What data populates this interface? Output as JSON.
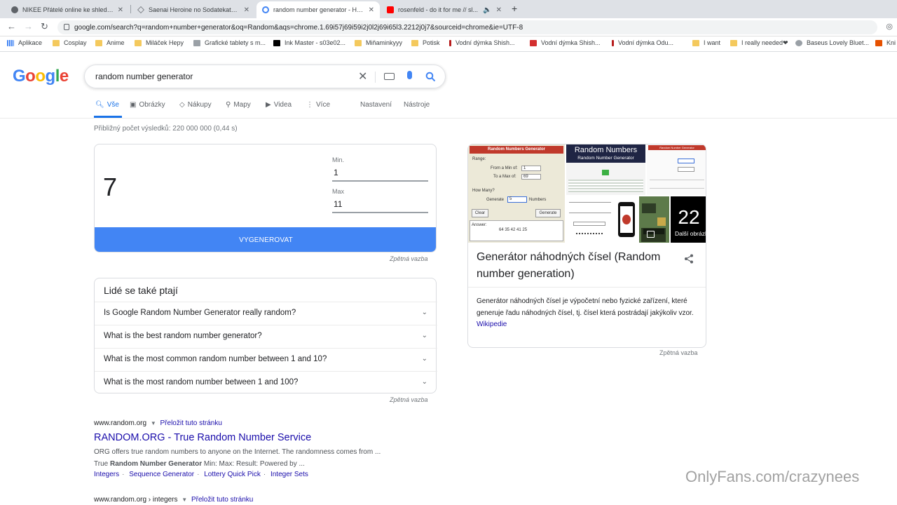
{
  "browser": {
    "tabs": [
      {
        "title": "NIKEE Přátelé online ke shlednutí",
        "active": false,
        "favicon_color": "#5f6368"
      },
      {
        "title": "Saenai Heroine no Sodatekata (C...",
        "active": false,
        "favicon_color": "#5f6368"
      },
      {
        "title": "random number generator - Hle...",
        "active": true,
        "favicon_color": "#4285f4"
      },
      {
        "title": "rosenfeld - do it for me // sl...",
        "active": false,
        "favicon_color": "#ff0000"
      }
    ],
    "address": "google.com/search?q=random+number+generator&oq=Random&aqs=chrome.1.69i57j69i59i2j0l2j69i65l3.2212j0j7&sourceid=chrome&ie=UTF-8",
    "bookmarks": [
      {
        "label": "Aplikace",
        "icon": "apps-grid-icon"
      },
      {
        "label": "Cosplay",
        "icon": "folder-icon"
      },
      {
        "label": "Anime",
        "icon": "folder-icon"
      },
      {
        "label": "Miláček Hepy",
        "icon": "folder-icon"
      },
      {
        "label": "Grafické tablety s m...",
        "icon": "page-icon"
      },
      {
        "label": "Ink Master - s03e02...",
        "icon": "video-icon"
      },
      {
        "label": "Miňaminkyyy",
        "icon": "folder-icon"
      },
      {
        "label": "Potisk",
        "icon": "folder-icon"
      },
      {
        "label": "Vodní dýmka Shish...",
        "icon": "hookah-icon"
      },
      {
        "label": "Vodní dýmka Shish...",
        "icon": "store-icon"
      },
      {
        "label": "Vodní dýmka Odu...",
        "icon": "hookah-icon"
      },
      {
        "label": "I want",
        "icon": "folder-icon"
      },
      {
        "label": "I really needed❤",
        "icon": "folder-icon"
      },
      {
        "label": "Baseus Lovely Bluet...",
        "icon": "page-icon"
      },
      {
        "label": "Kni",
        "icon": "page-icon"
      }
    ]
  },
  "google": {
    "logo": "Google",
    "query": "random number generator",
    "tabs": [
      {
        "label": "Vše",
        "icon": "search-icon",
        "active": true
      },
      {
        "label": "Obrázky",
        "icon": "image-icon",
        "active": false
      },
      {
        "label": "Nákupy",
        "icon": "tag-icon",
        "active": false
      },
      {
        "label": "Mapy",
        "icon": "map-pin-icon",
        "active": false
      },
      {
        "label": "Videa",
        "icon": "video-icon",
        "active": false
      },
      {
        "label": "Více",
        "icon": "more-vert-icon",
        "active": false
      }
    ],
    "settings_label": "Nastavení",
    "tools_label": "Nástroje",
    "stats": "Přibližný počet výsledků: 220 000 000 (0,44 s)"
  },
  "rng": {
    "result": "7",
    "min_label": "Min.",
    "min_value": "1",
    "max_label": "Max",
    "max_value": "11",
    "button_label": "VYGENEROVAT",
    "feedback": "Zpětná vazba"
  },
  "paa": {
    "heading": "Lidé se také ptají",
    "questions": [
      "Is Google Random Number Generator really random?",
      "What is the best random number generator?",
      "What is the most common random number between 1 and 10?",
      "What is the most random number between 1 and 100?"
    ],
    "feedback": "Zpětná vazba"
  },
  "results": [
    {
      "cite": "www.random.org",
      "translate": "Přeložit tuto stránku",
      "title": "RANDOM.ORG - True Random Number Service",
      "snippet1": "ORG offers true random numbers to anyone on the Internet. The randomness comes from ...",
      "snippet2_pre": "True ",
      "snippet2_bold": "Random Number Generator",
      "snippet2_post": " Min: Max: Result: Powered by ...",
      "sitelinks": [
        "Integers",
        "Sequence Generator",
        "Lottery Quick Pick",
        "Integer Sets"
      ]
    },
    {
      "cite": "www.random.org › integers",
      "translate": "Přeložit tuto stránku"
    }
  ],
  "knowledge_panel": {
    "thumb1": {
      "header": "Random Numbers Generator",
      "range": "Range:",
      "from": "From a Min of:",
      "from_val": "1",
      "to": "To a Max of:",
      "to_val": "69",
      "how_many": "How Many?",
      "generate": "Generate",
      "count": "5",
      "numbers": "Numbers",
      "clear": "Clear",
      "gen_btn": "Generate",
      "answer": "Answer:",
      "answer_val": "64  35  42  41  25"
    },
    "thumb2": {
      "title": "Random Numbers",
      "subtitle": "Random Number Generator"
    },
    "thumb3": {
      "header": "Random Number Generator"
    },
    "more_count": "22",
    "more_label": "Další obrázky",
    "title": "Generátor náhodných čísel (Random number generation)",
    "description": "Generátor náhodných čísel je výpočetní nebo fyzické zařízení, které generuje řadu náhodných čísel, tj. čísel která postrádají jakýkoliv vzor.",
    "source": "Wikipedie",
    "feedback": "Zpětná vazba"
  },
  "watermark": "OnlyFans.com/crazynees"
}
